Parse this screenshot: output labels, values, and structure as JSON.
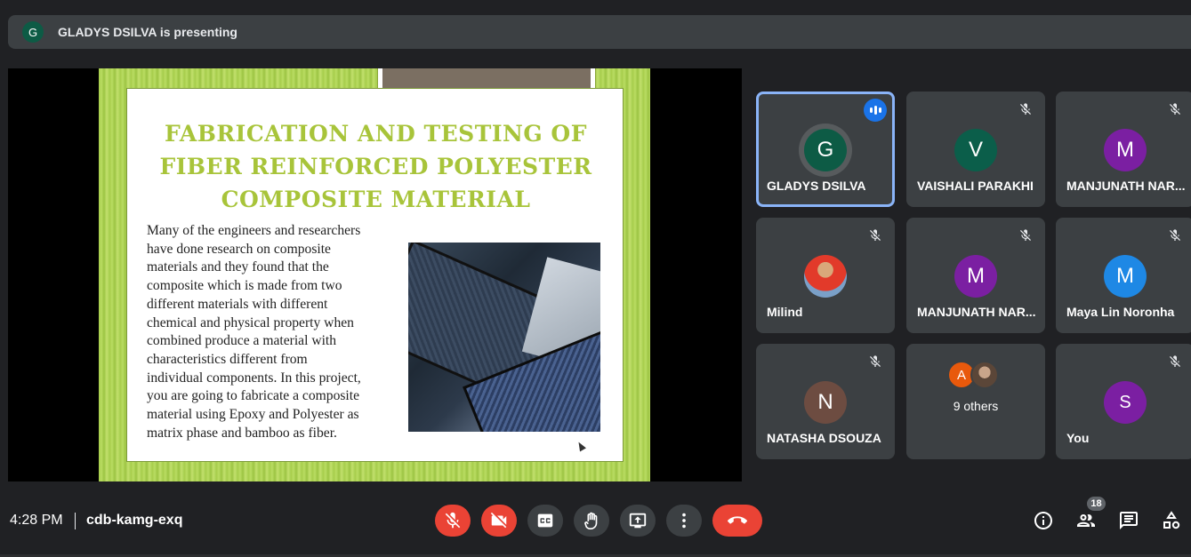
{
  "presenting": {
    "avatar_letter": "G",
    "text": "GLADYS DSILVA is presenting"
  },
  "slide": {
    "title": "FABRICATION AND TESTING OF\nFIBER REINFORCED POLYESTER\nCOMPOSITE MATERIAL",
    "body": "Many of the engineers and researchers\nhave done research on composite\nmaterials and they found that the\ncomposite which is made from two\ndifferent materials with different\nchemical and physical property when\ncombined produce a material with\ncharacteristics different from\nindividual components. In this project,\nyou are going to fabricate a composite\nmaterial using Epoxy and Polyester as\nmatrix phase and bamboo as fiber."
  },
  "participants": [
    {
      "name": "GLADYS DSILVA",
      "letter": "G",
      "color": "#0d5b45",
      "speaking": true
    },
    {
      "name": "VAISHALI PARAKHI",
      "letter": "V",
      "color": "#0b5e4a",
      "muted": true
    },
    {
      "name": "MANJUNATH NAR...",
      "letter": "M",
      "color": "#7b1fa2",
      "muted": true
    },
    {
      "name": "Milind",
      "letter": "",
      "photo": true,
      "muted": true
    },
    {
      "name": "MANJUNATH NAR...",
      "letter": "M",
      "color": "#7b1fa2",
      "muted": true
    },
    {
      "name": "Maya Lin Noronha",
      "letter": "M",
      "color": "#1e88e5",
      "muted": true
    },
    {
      "name": "NATASHA DSOUZA",
      "letter": "N",
      "color": "#6d4c41",
      "muted": true
    },
    {
      "name": "9 others",
      "others": true,
      "letter": "A"
    },
    {
      "name": "You",
      "letter": "S",
      "color": "#7b1fa2",
      "muted": true
    }
  ],
  "meeting": {
    "time": "4:28 PM",
    "code": "cdb-kamg-exq",
    "people_count": "18"
  },
  "colors": {
    "background": "#202124",
    "tile": "#3c4043",
    "danger": "#ea4335",
    "active_border": "#8ab4f8",
    "slide_title": "#a8c43a"
  },
  "icons": [
    "mic-off-icon",
    "camera-off-icon",
    "captions-icon",
    "raise-hand-icon",
    "present-icon",
    "more-options-icon",
    "end-call-icon",
    "info-icon",
    "people-icon",
    "chat-icon",
    "activities-icon"
  ]
}
